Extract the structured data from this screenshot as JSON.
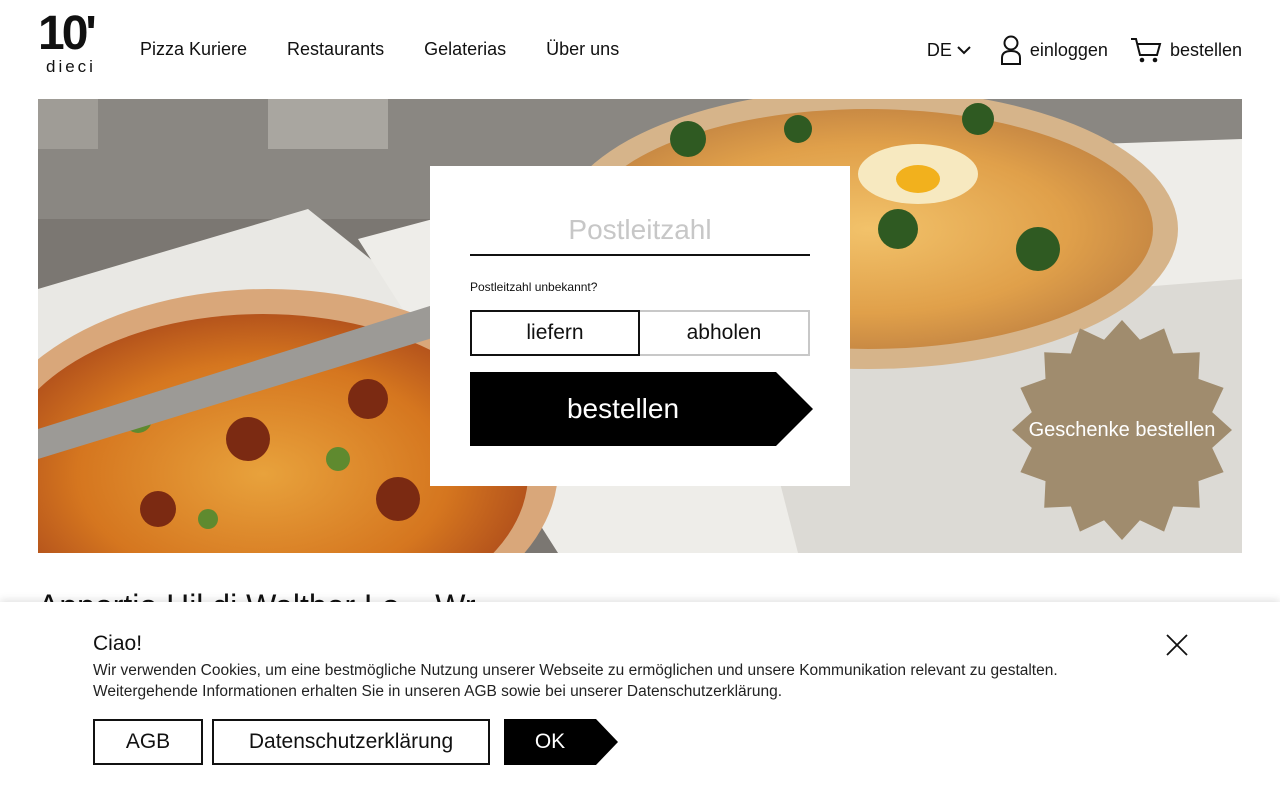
{
  "header": {
    "logo_number": "10'",
    "logo_word": "dieci",
    "nav": [
      "Pizza Kuriere",
      "Restaurants",
      "Gelaterias",
      "Über uns"
    ],
    "lang": "DE",
    "login": "einloggen",
    "cart": "bestellen"
  },
  "order_card": {
    "zip_placeholder": "Postleitzahl",
    "zip_unknown": "Postleitzahl unbekannt?",
    "deliver": "liefern",
    "pickup": "abholen",
    "order": "bestellen"
  },
  "gift_badge": "Geschenke bestellen",
  "below_text": "Apportio Hil di Walther Lo... Wr...",
  "cookie": {
    "title": "Ciao!",
    "text1": "Wir verwenden Cookies, um eine bestmögliche Nutzung unserer Webseite zu ermöglichen und unsere Kommunikation relevant zu gestalten.",
    "text2": "Weitergehende Informationen erhalten Sie in unseren AGB sowie bei unserer Datenschutzerklärung.",
    "agb": "AGB",
    "privacy": "Datenschutzerklärung",
    "ok": "OK"
  },
  "colors": {
    "badge": "#a08c6e",
    "button": "#000000"
  }
}
